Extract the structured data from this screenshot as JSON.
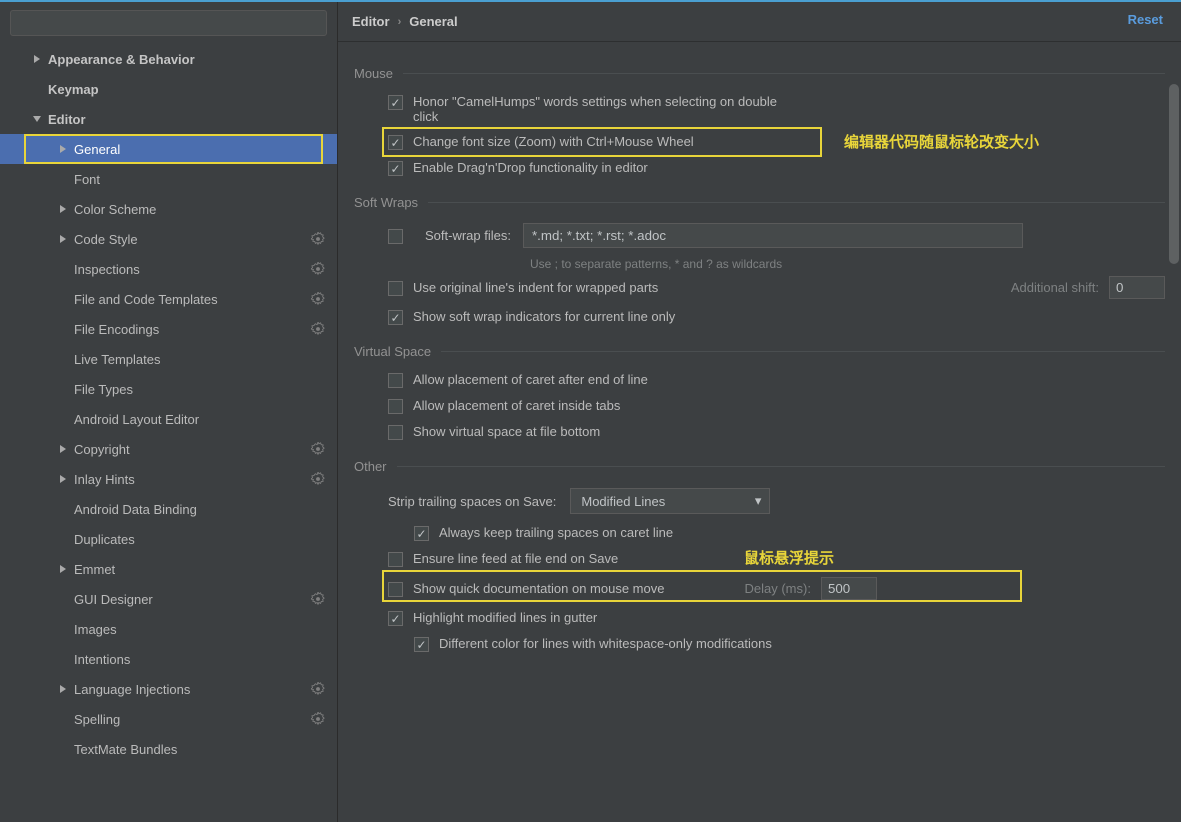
{
  "breadcrumb": {
    "root": "Editor",
    "sub": "General"
  },
  "resetLabel": "Reset",
  "search": {
    "placeholder": ""
  },
  "sidebar": {
    "items": [
      {
        "label": "Appearance & Behavior",
        "expandable": true,
        "open": false,
        "bold": true,
        "indent": 0
      },
      {
        "label": "Keymap",
        "bold": true,
        "indent": 0
      },
      {
        "label": "Editor",
        "expandable": true,
        "open": true,
        "bold": true,
        "indent": 0
      },
      {
        "label": "General",
        "expandable": true,
        "open": false,
        "indent": 1,
        "selected": true,
        "boxed": true
      },
      {
        "label": "Font",
        "indent": 1
      },
      {
        "label": "Color Scheme",
        "expandable": true,
        "open": false,
        "indent": 1
      },
      {
        "label": "Code Style",
        "expandable": true,
        "open": false,
        "indent": 1,
        "gear": true
      },
      {
        "label": "Inspections",
        "indent": 1,
        "gear": true
      },
      {
        "label": "File and Code Templates",
        "indent": 1,
        "gear": true
      },
      {
        "label": "File Encodings",
        "indent": 1,
        "gear": true
      },
      {
        "label": "Live Templates",
        "indent": 1
      },
      {
        "label": "File Types",
        "indent": 1
      },
      {
        "label": "Android Layout Editor",
        "indent": 1
      },
      {
        "label": "Copyright",
        "expandable": true,
        "open": false,
        "indent": 1,
        "gear": true
      },
      {
        "label": "Inlay Hints",
        "expandable": true,
        "open": false,
        "indent": 1,
        "gear": true
      },
      {
        "label": "Android Data Binding",
        "indent": 1
      },
      {
        "label": "Duplicates",
        "indent": 1
      },
      {
        "label": "Emmet",
        "expandable": true,
        "open": false,
        "indent": 1
      },
      {
        "label": "GUI Designer",
        "indent": 1,
        "gear": true
      },
      {
        "label": "Images",
        "indent": 1
      },
      {
        "label": "Intentions",
        "indent": 1
      },
      {
        "label": "Language Injections",
        "expandable": true,
        "open": false,
        "indent": 1,
        "gear": true
      },
      {
        "label": "Spelling",
        "indent": 1,
        "gear": true
      },
      {
        "label": "TextMate Bundles",
        "indent": 1
      }
    ]
  },
  "sections": {
    "mouse": {
      "title": "Mouse",
      "camelHumps": {
        "checked": true,
        "label": "Honor \"CamelHumps\" words settings when selecting on double click"
      },
      "fontZoom": {
        "checked": true,
        "label": "Change font size (Zoom) with Ctrl+Mouse Wheel"
      },
      "dnd": {
        "checked": true,
        "label": "Enable Drag'n'Drop functionality in editor"
      }
    },
    "softWraps": {
      "title": "Soft Wraps",
      "softWrapFiles": {
        "checked": false,
        "label": "Soft-wrap files:",
        "value": "*.md; *.txt; *.rst; *.adoc"
      },
      "hint": "Use ; to separate patterns, * and ? as wildcards",
      "useOriginalIndent": {
        "checked": false,
        "label": "Use original line's indent for wrapped parts"
      },
      "additionalShift": {
        "label": "Additional shift:",
        "value": "0"
      },
      "showIndicators": {
        "checked": true,
        "label": "Show soft wrap indicators for current line only"
      }
    },
    "virtualSpace": {
      "title": "Virtual Space",
      "afterEnd": {
        "checked": false,
        "label": "Allow placement of caret after end of line"
      },
      "insideTabs": {
        "checked": false,
        "label": "Allow placement of caret inside tabs"
      },
      "fileBottom": {
        "checked": false,
        "label": "Show virtual space at file bottom"
      }
    },
    "other": {
      "title": "Other",
      "stripLabel": "Strip trailing spaces on Save:",
      "stripValue": "Modified Lines",
      "alwaysKeep": {
        "checked": true,
        "label": "Always keep trailing spaces on caret line"
      },
      "ensureNewline": {
        "checked": false,
        "label": "Ensure line feed at file end on Save"
      },
      "quickDoc": {
        "checked": false,
        "label": "Show quick documentation on mouse move",
        "delayLabel": "Delay (ms):",
        "delayValue": "500"
      },
      "highlightMod": {
        "checked": true,
        "label": "Highlight modified lines in gutter"
      },
      "diffColorWs": {
        "checked": true,
        "label": "Different color for lines with whitespace-only modifications"
      }
    }
  },
  "annotations": {
    "fontZoom": "编辑器代码随鼠标轮改变大小",
    "hover": "鼠标悬浮提示"
  }
}
